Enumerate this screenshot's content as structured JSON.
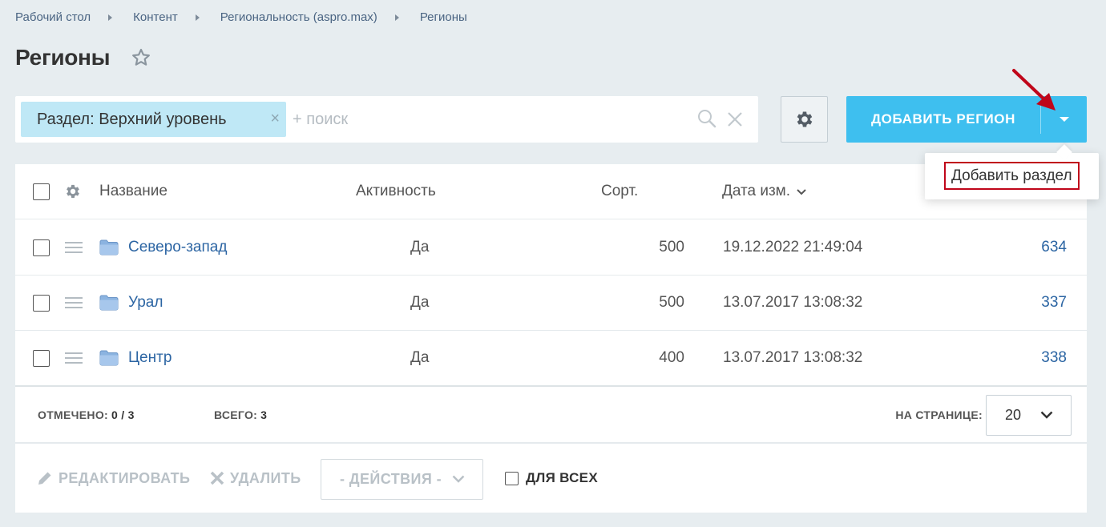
{
  "breadcrumb": [
    "Рабочий стол",
    "Контент",
    "Региональность (aspro.max)",
    "Регионы"
  ],
  "page": {
    "title": "Регионы"
  },
  "filter": {
    "chip_label": "Раздел: Верхний уровень",
    "chip_remove": "×",
    "search_placeholder": "+ поиск"
  },
  "toolbar": {
    "add_label": "ДОБАВИТЬ РЕГИОН"
  },
  "dropdown": {
    "items": [
      "Добавить раздел"
    ]
  },
  "table": {
    "columns": [
      "Название",
      "Активность",
      "Сорт.",
      "Дата изм."
    ],
    "rows": [
      {
        "name": "Северо-запад",
        "active": "Да",
        "sort": "500",
        "date": "19.12.2022 21:49:04",
        "id": "634"
      },
      {
        "name": "Урал",
        "active": "Да",
        "sort": "500",
        "date": "13.07.2017 13:08:32",
        "id": "337"
      },
      {
        "name": "Центр",
        "active": "Да",
        "sort": "400",
        "date": "13.07.2017 13:08:32",
        "id": "338"
      }
    ]
  },
  "summary": {
    "selected_label": "ОТМЕЧЕНО:",
    "selected_value": "0 / 3",
    "total_label": "ВСЕГО:",
    "total_value": "3",
    "per_page_label": "НА СТРАНИЦЕ:",
    "per_page_value": "20"
  },
  "actions": {
    "edit": "РЕДАКТИРОВАТЬ",
    "delete": "УДАЛИТЬ",
    "select": "- ДЕЙСТВИЯ -",
    "for_all": "ДЛЯ ВСЕХ"
  },
  "colors": {
    "accent": "#3ebfef",
    "link": "#2c65a3",
    "chip_bg": "#bfe8f6",
    "highlight_border": "#c0061a"
  },
  "icons": [
    "star-icon",
    "search-icon",
    "clear-icon",
    "gear-icon",
    "caret-down-icon",
    "folder-icon",
    "drag-handle-icon",
    "pencil-icon",
    "cross-icon",
    "chevron-down-icon",
    "annotation-arrow-icon"
  ]
}
